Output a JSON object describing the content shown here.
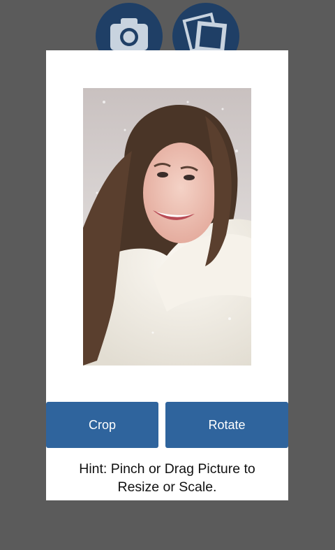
{
  "toolbar": {
    "camera_icon": "camera-icon",
    "gallery_icon": "photo-gallery-icon"
  },
  "dialog": {
    "photo_subject": "portrait-photo",
    "crop_label": "Crop",
    "rotate_label": "Rotate",
    "hint_line1": "Hint: Pinch or Drag Picture to",
    "hint_line2": "Resize or Scale."
  },
  "colors": {
    "background": "#5b5b5b",
    "icon_circle": "#1f3f66",
    "button": "#2f649d",
    "dialog": "#ffffff"
  }
}
